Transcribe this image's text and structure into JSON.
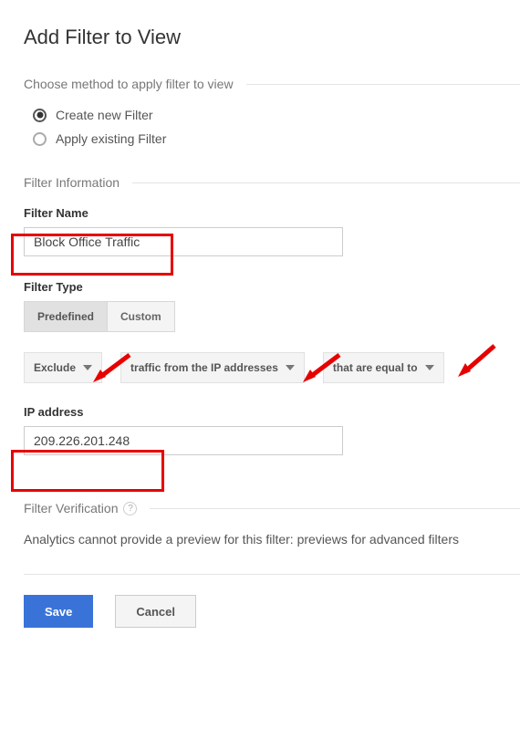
{
  "page": {
    "title": "Add Filter to View"
  },
  "method": {
    "heading": "Choose method to apply filter to view",
    "create": "Create new Filter",
    "existing": "Apply existing Filter"
  },
  "info": {
    "heading": "Filter Information",
    "name_label": "Filter Name",
    "name_value": "Block Office Traffic",
    "type_label": "Filter Type",
    "tab_predefined": "Predefined",
    "tab_custom": "Custom",
    "drop_exclude": "Exclude",
    "drop_source": "traffic from the IP addresses",
    "drop_match": "that are equal to",
    "ip_label": "IP address",
    "ip_value": "209.226.201.248"
  },
  "verify": {
    "heading": "Filter Verification",
    "message": "Analytics cannot provide a preview for this filter: previews for advanced filters"
  },
  "buttons": {
    "save": "Save",
    "cancel": "Cancel"
  }
}
